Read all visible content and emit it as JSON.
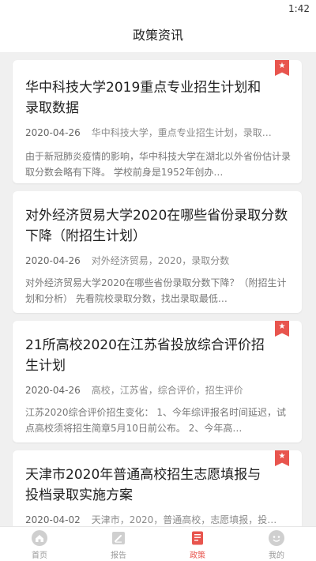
{
  "status": {
    "time": "1:42"
  },
  "header": {
    "title": "政策资讯"
  },
  "articles": [
    {
      "title": "华中科技大学2019重点专业招生计划和录取数据",
      "date": "2020-04-26",
      "tags": "华中科技大学，重点专业招生计划，录取…",
      "summary": "由于新冠肺炎疫情的影响，华中科技大学在湖北以外省份估计录取分数会略有下降。 学校前身是1952年创办…"
    },
    {
      "title": "对外经济贸易大学2020在哪些省份录取分数下降（附招生计划）",
      "date": "2020-04-26",
      "tags": "对外经济贸易，2020，录取分数",
      "summary": "对外经济贸易大学2020在哪些省份录取分数下降？（附招生计划和分析） 先看院校录取分数，找出录取最低…"
    },
    {
      "title": "21所高校2020在江苏省投放综合评价招生计划",
      "date": "2020-04-26",
      "tags": "高校，江苏省，综合评价，招生评价",
      "summary": "江苏2020综合评价招生变化： 1、今年综评报名时间延迟，试点高校须将招生简章5月10日前公布。 2、今年高…"
    },
    {
      "title": "天津市2020年普通高校招生志愿填报与投档录取实施方案",
      "date": "2020-04-02",
      "tags": "天津市，2020，普通高校，志愿填报，投…",
      "summary": ""
    }
  ],
  "tabs": [
    {
      "label": "首页",
      "icon": "home-icon"
    },
    {
      "label": "报告",
      "icon": "report-icon"
    },
    {
      "label": "政策",
      "icon": "policy-icon"
    },
    {
      "label": "我的",
      "icon": "profile-icon"
    }
  ],
  "active_tab": "政策",
  "colors": {
    "accent": "#e8554e",
    "background": "#f0f0f0"
  }
}
